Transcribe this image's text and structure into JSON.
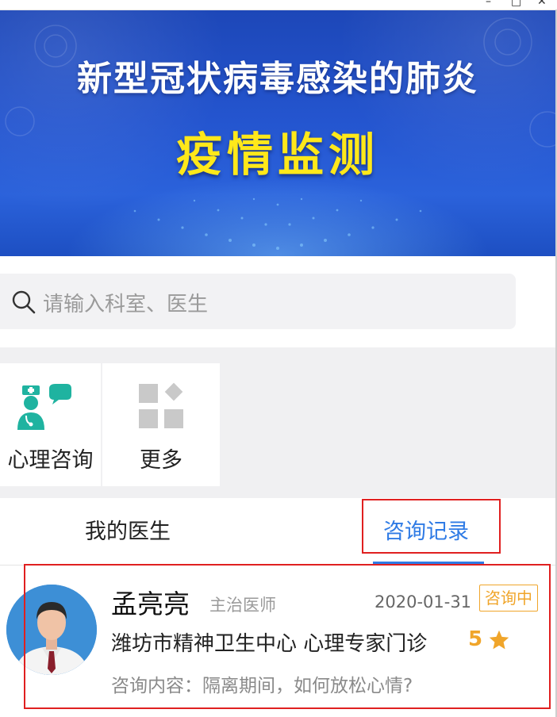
{
  "window": {
    "minimize": "–",
    "maximize": "□",
    "close": "✕"
  },
  "banner": {
    "title": "新型冠状病毒感染的肺炎",
    "subtitle": "疫情监测"
  },
  "search": {
    "placeholder": "请输入科室、医生"
  },
  "services": [
    {
      "label": "心理咨询",
      "icon": "doctor-chat-icon"
    },
    {
      "label": "更多",
      "icon": "more-grid-icon"
    }
  ],
  "tabs": [
    {
      "label": "我的医生",
      "active": false
    },
    {
      "label": "咨询记录",
      "active": true
    }
  ],
  "consultation": {
    "doctor_name": "孟亮亮",
    "doctor_title": "主治医师",
    "date": "2020-01-31",
    "status": "咨询中",
    "organization": "潍坊市精神卫生中心 心理专家门诊",
    "rating": "5",
    "content": "咨询内容：隔离期间，如何放松心情?"
  },
  "colors": {
    "accent": "#2f7be5",
    "status": "#f0a52a",
    "banner_title": "#ffffff",
    "banner_subtitle": "#ffe81a",
    "highlight_box": "#e02020"
  }
}
